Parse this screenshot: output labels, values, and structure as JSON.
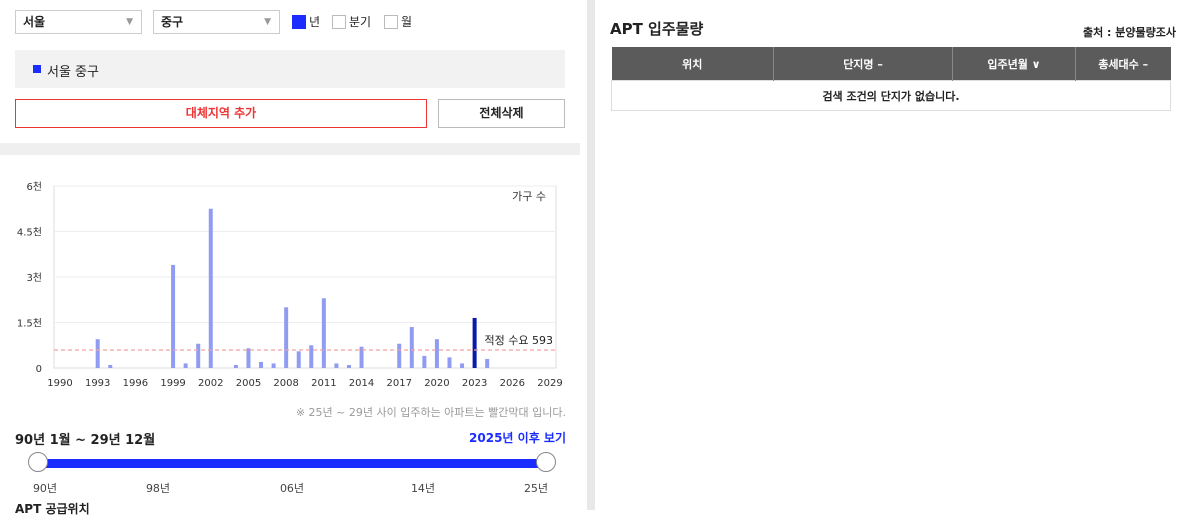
{
  "filters": {
    "city": "서울",
    "district": "중구",
    "period_options": [
      {
        "label": "년",
        "checked": true
      },
      {
        "label": "분기",
        "checked": false
      },
      {
        "label": "월",
        "checked": false
      }
    ]
  },
  "region_chip": "서울 중구",
  "buttons": {
    "add_region": "대체지역 추가",
    "delete_all": "전체삭제"
  },
  "chart_data": {
    "type": "bar",
    "title": "",
    "series_label": "가구 수",
    "x": [
      1990,
      1991,
      1992,
      1993,
      1994,
      1995,
      1996,
      1997,
      1998,
      1999,
      2000,
      2001,
      2002,
      2003,
      2004,
      2005,
      2006,
      2007,
      2008,
      2009,
      2010,
      2011,
      2012,
      2013,
      2014,
      2015,
      2016,
      2017,
      2018,
      2019,
      2020,
      2021,
      2022,
      2023,
      2024,
      2025,
      2026,
      2027,
      2028,
      2029
    ],
    "values": [
      0,
      0,
      0,
      950,
      100,
      0,
      0,
      0,
      0,
      3400,
      150,
      800,
      5250,
      0,
      100,
      650,
      200,
      150,
      2000,
      550,
      750,
      2300,
      150,
      100,
      700,
      0,
      0,
      800,
      1350,
      400,
      950,
      350,
      150,
      1650,
      300,
      0,
      0,
      0,
      0,
      0
    ],
    "highlight_year": 2023,
    "x_ticks": [
      "1990",
      "1993",
      "1996",
      "1999",
      "2002",
      "2005",
      "2008",
      "2011",
      "2014",
      "2017",
      "2020",
      "2023",
      "2026",
      "2029"
    ],
    "y_ticks": [
      "0",
      "1.5천",
      "3천",
      "4.5천",
      "6천"
    ],
    "ylim": [
      0,
      6000
    ],
    "reference_line": {
      "value": 593,
      "label": "적정 수요 593"
    },
    "colors": {
      "bar": "#8f9cf2",
      "highlight": "#0a1aa8",
      "reference": "#f4a0a0"
    }
  },
  "note": "※ 25년 ~ 29년 사이 입주하는 아파트는 빨간막대 입니다.",
  "range": {
    "label": "90년 1월 ~ 29년 12월",
    "after_link": "2025년 이후 보기",
    "ticks": [
      "90년",
      "98년",
      "06년",
      "14년",
      "25년"
    ],
    "start_fraction": 0,
    "end_fraction": 1
  },
  "supply_cut": "APT 공급위치",
  "right": {
    "title": "APT 입주물량",
    "source": "출처 : 분양물량조사",
    "columns": [
      "위치",
      "단지명 –",
      "입주년월 ∨",
      "총세대수 –"
    ],
    "empty_text": "검색 조건의 단지가 없습니다."
  }
}
